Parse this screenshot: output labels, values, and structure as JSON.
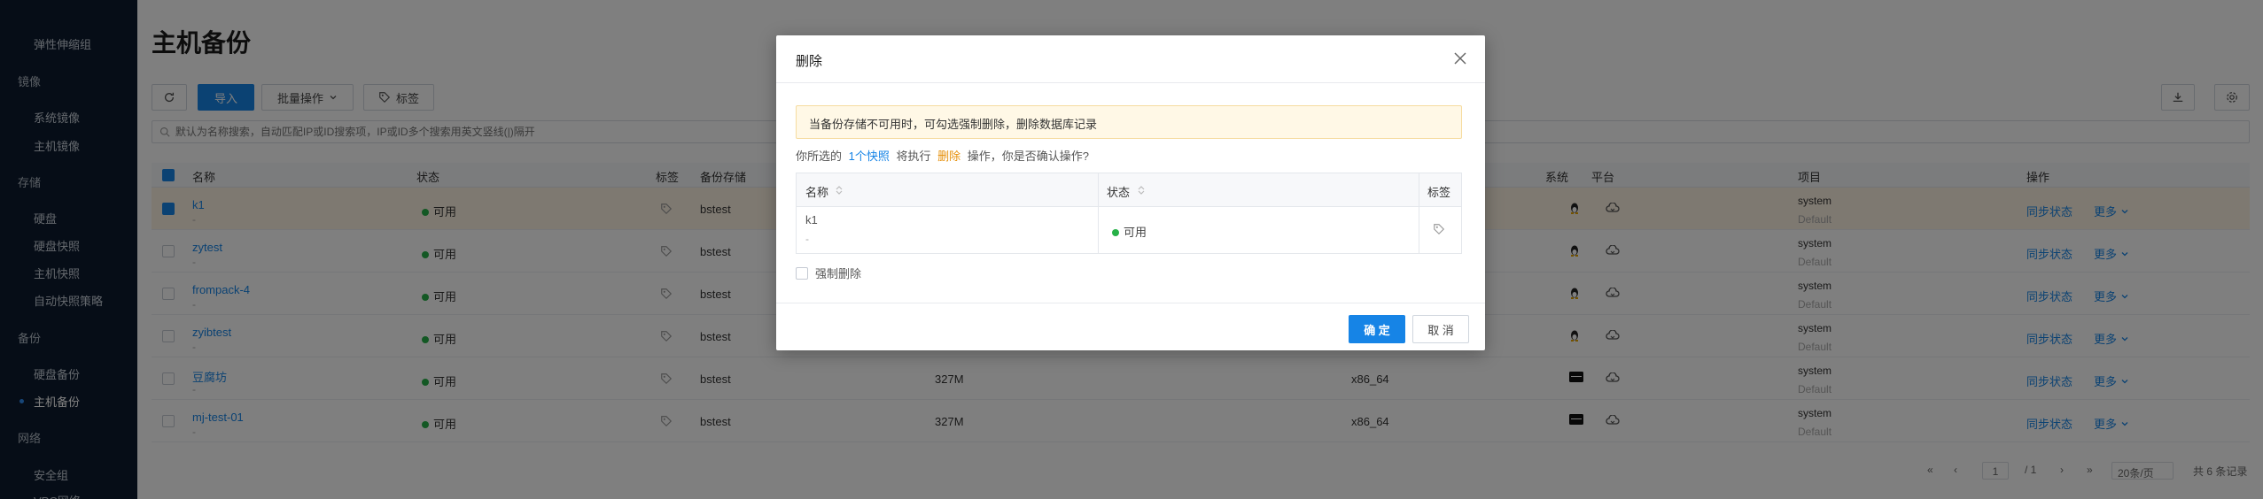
{
  "sidebar": {
    "items": [
      {
        "label": "弹性伸缩组",
        "type": "item"
      },
      {
        "label": "镜像",
        "type": "group"
      },
      {
        "label": "系统镜像",
        "type": "item"
      },
      {
        "label": "主机镜像",
        "type": "item"
      },
      {
        "label": "存储",
        "type": "group"
      },
      {
        "label": "硬盘",
        "type": "item"
      },
      {
        "label": "硬盘快照",
        "type": "item"
      },
      {
        "label": "主机快照",
        "type": "item"
      },
      {
        "label": "自动快照策略",
        "type": "item"
      },
      {
        "label": "备份",
        "type": "group"
      },
      {
        "label": "硬盘备份",
        "type": "item"
      },
      {
        "label": "主机备份",
        "type": "item",
        "active": true
      },
      {
        "label": "网络",
        "type": "group"
      },
      {
        "label": "安全组",
        "type": "item"
      },
      {
        "label": "VPC网络",
        "type": "item"
      }
    ]
  },
  "page": {
    "title": "主机备份"
  },
  "toolbar": {
    "import_label": "导入",
    "batch_label": "批量操作",
    "tag_label": "标签"
  },
  "search": {
    "placeholder": "默认为名称搜索，自动匹配IP或ID搜索项，IP或ID多个搜索用英文竖线(|)隔开"
  },
  "table": {
    "headers": {
      "name": "名称",
      "status": "状态",
      "tag": "标签",
      "storage": "备份存储",
      "system": "系统",
      "platform": "平台",
      "project": "项目",
      "ops": "操作"
    },
    "rows": [
      {
        "name": "k1",
        "sub": "-",
        "status": "可用",
        "storage": "bstest",
        "size": "",
        "arch": "",
        "os": "linux",
        "project": "system",
        "domain": "Default",
        "selected": true
      },
      {
        "name": "zytest",
        "sub": "-",
        "status": "可用",
        "storage": "bstest",
        "size": "",
        "arch": "",
        "os": "linux",
        "project": "system",
        "domain": "Default",
        "selected": false
      },
      {
        "name": "frompack-4",
        "sub": "-",
        "status": "可用",
        "storage": "bstest",
        "size": "",
        "arch": "",
        "os": "linux",
        "project": "system",
        "domain": "Default",
        "selected": false
      },
      {
        "name": "zyibtest",
        "sub": "-",
        "status": "可用",
        "storage": "bstest",
        "size": "",
        "arch": "",
        "os": "linux",
        "project": "system",
        "domain": "Default",
        "selected": false
      },
      {
        "name": "豆腐坊",
        "sub": "-",
        "status": "可用",
        "storage": "bstest",
        "size": "327M",
        "arch": "x86_64",
        "os": "windows",
        "project": "system",
        "domain": "Default",
        "selected": false
      },
      {
        "name": "mj-test-01",
        "sub": "-",
        "status": "可用",
        "storage": "bstest",
        "size": "327M",
        "arch": "x86_64",
        "os": "windows",
        "project": "system",
        "domain": "Default",
        "selected": false
      }
    ],
    "op_sync": "同步状态",
    "op_more": "更多"
  },
  "pager": {
    "current": "1",
    "total_pages": "/ 1",
    "page_size": "20条/页",
    "total": "共 6 条记录"
  },
  "modal": {
    "title": "删除",
    "alert": "当备份存储不可用时，可勾选强制删除，删除数据库记录",
    "confirm_prefix": "你所选的",
    "confirm_count": "1个快照",
    "confirm_mid": "将执行",
    "confirm_op": "删除",
    "confirm_suffix": "操作，你是否确认操作?",
    "table_headers": {
      "name": "名称",
      "status": "状态",
      "tag": "标签"
    },
    "row": {
      "name": "k1",
      "sub": "-",
      "status": "可用"
    },
    "force_label": "强制删除",
    "ok_label": "确 定",
    "cancel_label": "取 消"
  },
  "colors": {
    "primary": "#1684e6",
    "sidebar_bg": "#0d1b2e",
    "status_green": "#27b148",
    "warn_orange": "#e6900b"
  }
}
